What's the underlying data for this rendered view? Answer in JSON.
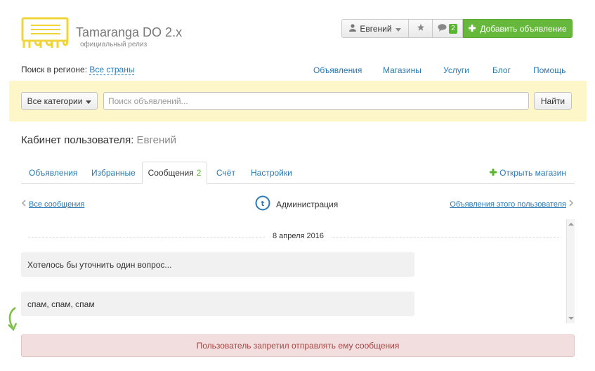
{
  "brand": {
    "title": "Tamaranga DO 2.x",
    "subtitle": "официальный релиз"
  },
  "header": {
    "user_label": "Евгений",
    "messages_count": "2",
    "add_ad_label": "Добавить объявление"
  },
  "region": {
    "label": "Поиск в регионе:",
    "value": "Все страны"
  },
  "nav": [
    "Объявления",
    "Магазины",
    "Услуги",
    "Блог",
    "Помощь"
  ],
  "search": {
    "category_label": "Все категории",
    "placeholder": "Поиск объявлений...",
    "button_label": "Найти"
  },
  "cabinet": {
    "title": "Кабинет пользователя:",
    "user": "Евгений"
  },
  "tabs": [
    {
      "label": "Объявления"
    },
    {
      "label": "Избранные"
    },
    {
      "label": "Сообщения",
      "count": "2"
    },
    {
      "label": "Счёт"
    },
    {
      "label": "Настройки"
    }
  ],
  "open_shop_label": "Открыть магазин",
  "conversation": {
    "back_label": "Все сообщения",
    "name": "Администрация",
    "user_ads_label": "Объявления этого пользователя",
    "date": "8 апреля 2016",
    "messages": [
      "Хотелось бы уточнить один вопрос...",
      "спам, спам, спам"
    ]
  },
  "alert_text": "Пользователь запретил отправлять ему сообщения",
  "colors": {
    "accent": "#66b83c",
    "link": "#2a7ab8",
    "search_band": "#fcf6c8",
    "logo": "#f0d53a",
    "alert_bg": "#f2dede",
    "alert_text": "#a94442"
  },
  "icons": [
    "logo-icon",
    "user-icon",
    "caret-down-icon",
    "star-icon",
    "chat-icon",
    "plus-icon",
    "chevron-left-icon",
    "admin-logo-icon",
    "chevron-right-icon",
    "curved-arrow-icon"
  ]
}
